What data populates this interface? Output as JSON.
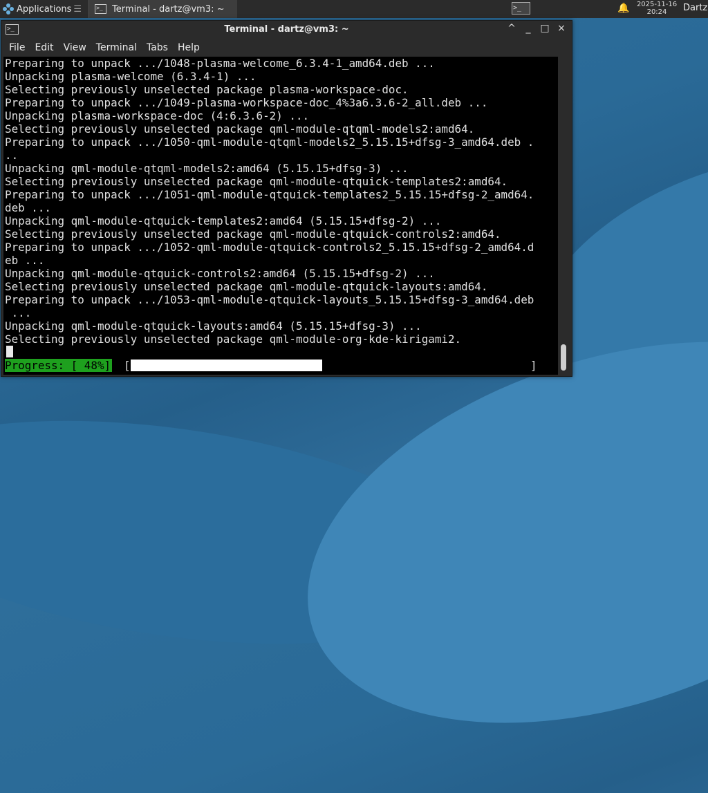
{
  "panel": {
    "applications_label": "Applications",
    "task_title": "Terminal - dartz@vm3: ~",
    "clock_date": "2025-11-16",
    "clock_time": "20:24",
    "user": "Dartz",
    "icons": [
      "applications-logo-icon",
      "terminal-icon",
      "bell-icon"
    ]
  },
  "window": {
    "title": "Terminal - dartz@vm3: ~",
    "buttons": {
      "keep_above": "^",
      "minimize": "_",
      "maximize": "□",
      "close": "×"
    },
    "menu": [
      "File",
      "Edit",
      "View",
      "Terminal",
      "Tabs",
      "Help"
    ]
  },
  "terminal": {
    "lines": [
      "Preparing to unpack .../1048-plasma-welcome_6.3.4-1_amd64.deb ...",
      "Unpacking plasma-welcome (6.3.4-1) ...",
      "Selecting previously unselected package plasma-workspace-doc.",
      "Preparing to unpack .../1049-plasma-workspace-doc_4%3a6.3.6-2_all.deb ...",
      "Unpacking plasma-workspace-doc (4:6.3.6-2) ...",
      "Selecting previously unselected package qml-module-qtqml-models2:amd64.",
      "Preparing to unpack .../1050-qml-module-qtqml-models2_5.15.15+dfsg-3_amd64.deb .",
      "..",
      "Unpacking qml-module-qtqml-models2:amd64 (5.15.15+dfsg-3) ...",
      "Selecting previously unselected package qml-module-qtquick-templates2:amd64.",
      "Preparing to unpack .../1051-qml-module-qtquick-templates2_5.15.15+dfsg-2_amd64.",
      "deb ...",
      "Unpacking qml-module-qtquick-templates2:amd64 (5.15.15+dfsg-2) ...",
      "Selecting previously unselected package qml-module-qtquick-controls2:amd64.",
      "Preparing to unpack .../1052-qml-module-qtquick-controls2_5.15.15+dfsg-2_amd64.d",
      "eb ...",
      "Unpacking qml-module-qtquick-controls2:amd64 (5.15.15+dfsg-2) ...",
      "Selecting previously unselected package qml-module-qtquick-layouts:amd64.",
      "Preparing to unpack .../1053-qml-module-qtquick-layouts_5.15.15+dfsg-3_amd64.deb",
      " ...",
      "Unpacking qml-module-qtquick-layouts:amd64 (5.15.15+dfsg-3) ...",
      "Selecting previously unselected package qml-module-org-kde-kirigami2."
    ],
    "progress_label": "Progress: [ 48%]",
    "progress_left_bracket": "[",
    "progress_right_bracket": "]",
    "progress_fraction": 0.48
  },
  "colors": {
    "terminal_bg": "#000000",
    "terminal_fg": "#e0e0e0",
    "progress_label_bg": "#1ea01e",
    "progress_fill": "#ffffff",
    "panel_bg": "#2b2b2b"
  }
}
